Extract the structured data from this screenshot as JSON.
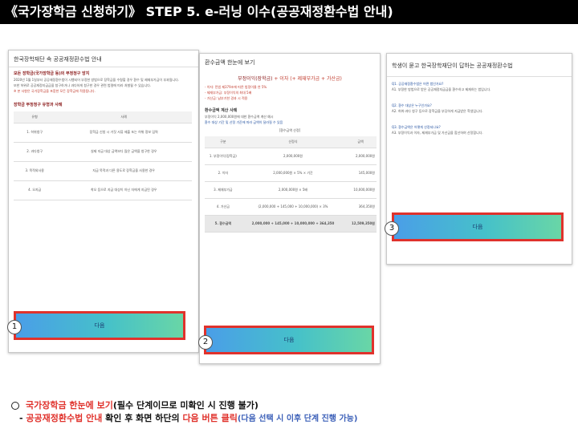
{
  "header": {
    "title": "《국가장학금 신청하기》 STEP 5. e-러닝 이수(공공재정환수법 안내)"
  },
  "panel1": {
    "title": "한국장학재단 속 공공재정환수법 안내",
    "section1": "모든 장학금(국가장학금 등)의 부정청구 방지",
    "lines": [
      "2020년 1월 1일부터 공공재정환수법이 시행되어 부정한 방법으로 장학금을 수령할 경우 환수 및 제재부가금이 부과됩니다.",
      "또한 허위로 공공재정지급금을 청구하거나 과다하게 청구한 경우 관련 법령에 따라 처벌될 수 있습니다.",
      "※ 본 사항은 국가장학금을 포함한 모든 장학금에 적용됩니다."
    ],
    "section2": "장학금 부정청구 유형과 사례",
    "table": {
      "headers": [
        "유형",
        "사례"
      ],
      "rows": [
        [
          "1. 허위청구",
          "장학금 신청 시 거짓 서류 제출 또는 허위 정보 입력"
        ],
        [
          "2. 과다청구",
          "실제 지급 대상 금액보다 많은 금액을 청구한 경우"
        ],
        [
          "3. 목적외사용",
          "지급 목적과 다른 용도로 장학금을 사용한 경우"
        ],
        [
          "4. 오지급",
          "착오 등으로 지급 대상이 아닌 자에게 지급된 경우"
        ]
      ]
    },
    "button_label": "다음"
  },
  "panel2": {
    "title": "환수금액 한눈에 보기",
    "formula": {
      "main": "부정이익(장학금)",
      "plus1": " + 이자 ",
      "rest": "(+ 제재부가금 + 가산금)"
    },
    "lines": [
      "- 이자: 민법 제379조에 따른 법정이율 연 5%",
      "- 제재부가금: 부정이익의 최대 5배",
      "- 가산금: 납부기한 경과 시 적용"
    ],
    "section1": "환수금액 계산 사례",
    "case_lines": [
      "부정이익 2,000,000원에 대한 환수금액 계산 예시",
      "환수 대상 기간 및 산정 기준에 따라 금액이 달라질 수 있음"
    ],
    "table_caption": "[환수금액 산정]",
    "table": {
      "headers": [
        "구분",
        "산정식",
        "금액"
      ],
      "rows": [
        [
          "1. 부정이익(장학금)",
          "2,000,000원",
          "2,000,000원"
        ],
        [
          "2. 이자",
          "2,000,000원 × 5% × 기간",
          "145,000원"
        ],
        [
          "3. 제재부가금",
          "2,000,000원 × 5배",
          "10,000,000원"
        ],
        [
          "4. 가산금",
          "(2,000,000 + 145,000 + 10,000,000) × 3%",
          "364,350원"
        ]
      ],
      "total": [
        "5. 환수금액",
        "2,000,000 + 145,000 + 10,000,000 + 364,350",
        "12,509,350원"
      ]
    },
    "button_label": "다음"
  },
  "panel3": {
    "title": "학생이 묻고 한국장학재단이 답하는 공공재정환수법",
    "qa": [
      "Q1. 공공재정환수법은 어떤 법인가요?",
      "A1. 부정한 방법으로 받은 공공재정지급금을 환수하고 제재하는 법입니다.",
      "Q2. 환수 대상은 누구인가요?",
      "A2. 허위·과다 청구 등으로 장학금을 부당하게 지급받은 학생입니다.",
      "Q3. 환수금액은 어떻게 산정되나요?",
      "A3. 부정이익과 이자, 제재부가금 및 가산금을 합산하여 산정합니다."
    ],
    "button_label": "다음"
  },
  "badges": [
    "1",
    "2",
    "3"
  ],
  "instructions": {
    "row1_red": "국가장학금 한눈에 보기",
    "row1_black": "(필수 단계이므로 미확인 시 진행 불가)",
    "row2_dash": "- ",
    "row2_red1": "공공재정환수법 안내",
    "row2_black1": " 확인 후 화면 하단의 ",
    "row2_red2": "다음 버튼 클릭",
    "row2_blue": "(다음 선택 시 이후 단계 진행 가능)"
  },
  "colors": {
    "accent_red": "#e0322c",
    "accent_blue": "#3b5fb8",
    "button_gradient_start": "#4a9ee8",
    "button_gradient_end": "#69d6a6"
  }
}
